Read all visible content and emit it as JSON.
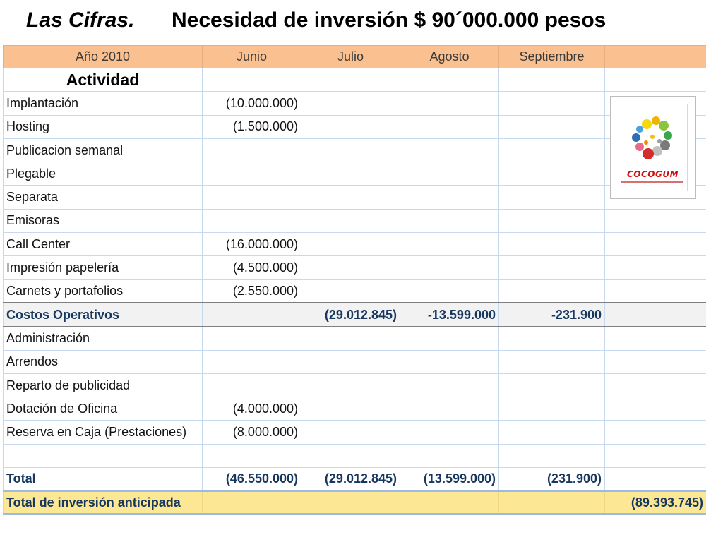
{
  "slide": {
    "title_left": "Las Cifras.",
    "title_right": "Necesidad de inversión $ 90´000.000 pesos"
  },
  "table": {
    "headers": [
      "Año 2010",
      "Junio",
      "Julio",
      "Agosto",
      "Septiembre",
      ""
    ],
    "rows": [
      {
        "label": "Actividad",
        "values": [
          "",
          "",
          "",
          "",
          ""
        ]
      },
      {
        "label": "Implantación",
        "values": [
          "(10.000.000)",
          "",
          "",
          "",
          ""
        ]
      },
      {
        "label": "Hosting",
        "values": [
          "(1.500.000)",
          "",
          "",
          "",
          ""
        ]
      },
      {
        "label": "Publicacion semanal",
        "values": [
          "",
          "",
          "",
          "",
          ""
        ]
      },
      {
        "label": "Plegable",
        "values": [
          "",
          "",
          "",
          "",
          ""
        ]
      },
      {
        "label": "Separata",
        "values": [
          "",
          "",
          "",
          "",
          ""
        ]
      },
      {
        "label": "Emisoras",
        "values": [
          "",
          "",
          "",
          "",
          ""
        ]
      },
      {
        "label": "Call Center",
        "values": [
          "(16.000.000)",
          "",
          "",
          "",
          ""
        ]
      },
      {
        "label": "Impresión papelería",
        "values": [
          "(4.500.000)",
          "",
          "",
          "",
          ""
        ]
      },
      {
        "label": "Carnets y portafolios",
        "values": [
          "(2.550.000)",
          "",
          "",
          "",
          ""
        ]
      },
      {
        "label": "Costos Operativos",
        "values": [
          "",
          "(29.012.845)",
          "-13.599.000",
          "-231.900",
          ""
        ]
      },
      {
        "label": "Administración",
        "values": [
          "",
          "",
          "",
          "",
          ""
        ]
      },
      {
        "label": "Arrendos",
        "values": [
          "",
          "",
          "",
          "",
          ""
        ]
      },
      {
        "label": "Reparto de publicidad",
        "values": [
          "",
          "",
          "",
          "",
          ""
        ]
      },
      {
        "label": "Dotación de Oficina",
        "values": [
          "(4.000.000)",
          "",
          "",
          "",
          ""
        ]
      },
      {
        "label": "Reserva en Caja (Prestaciones)",
        "values": [
          "(8.000.000)",
          "",
          "",
          "",
          ""
        ]
      },
      {
        "label": "",
        "values": [
          "",
          "",
          "",
          "",
          ""
        ]
      },
      {
        "label": "Total",
        "values": [
          "(46.550.000)",
          "(29.012.845)",
          "(13.599.000)",
          "(231.900)",
          ""
        ]
      },
      {
        "label": "Total de inversión anticipada",
        "values": [
          "",
          "",
          "",
          "",
          "(89.393.745)"
        ]
      }
    ]
  },
  "logo": {
    "name": "COCOGUM",
    "icon": "cocogum-logo-icon"
  },
  "colors": {
    "header_bg": "#fac090",
    "total_bg": "#fce795",
    "accent_text": "#17375e",
    "logo_red": "#d01010"
  }
}
